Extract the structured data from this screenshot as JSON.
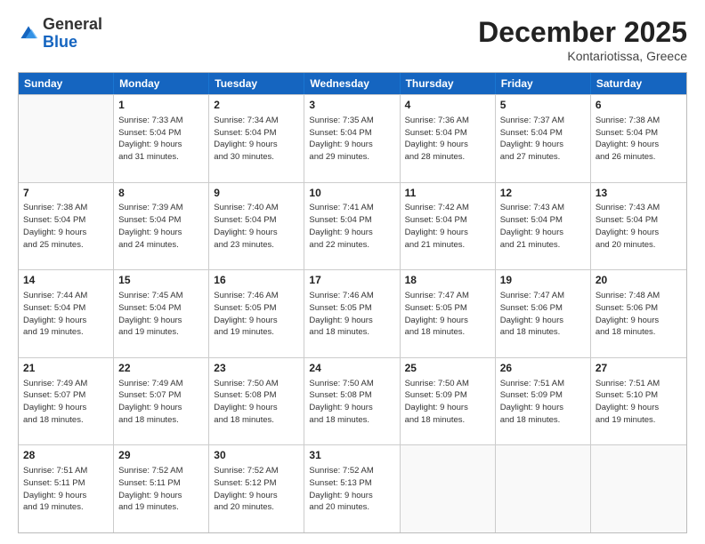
{
  "header": {
    "logo_general": "General",
    "logo_blue": "Blue",
    "month_title": "December 2025",
    "location": "Kontariotissa, Greece"
  },
  "days_of_week": [
    "Sunday",
    "Monday",
    "Tuesday",
    "Wednesday",
    "Thursday",
    "Friday",
    "Saturday"
  ],
  "weeks": [
    [
      {
        "day": "",
        "info": ""
      },
      {
        "day": "1",
        "info": "Sunrise: 7:33 AM\nSunset: 5:04 PM\nDaylight: 9 hours\nand 31 minutes."
      },
      {
        "day": "2",
        "info": "Sunrise: 7:34 AM\nSunset: 5:04 PM\nDaylight: 9 hours\nand 30 minutes."
      },
      {
        "day": "3",
        "info": "Sunrise: 7:35 AM\nSunset: 5:04 PM\nDaylight: 9 hours\nand 29 minutes."
      },
      {
        "day": "4",
        "info": "Sunrise: 7:36 AM\nSunset: 5:04 PM\nDaylight: 9 hours\nand 28 minutes."
      },
      {
        "day": "5",
        "info": "Sunrise: 7:37 AM\nSunset: 5:04 PM\nDaylight: 9 hours\nand 27 minutes."
      },
      {
        "day": "6",
        "info": "Sunrise: 7:38 AM\nSunset: 5:04 PM\nDaylight: 9 hours\nand 26 minutes."
      }
    ],
    [
      {
        "day": "7",
        "info": "Sunrise: 7:38 AM\nSunset: 5:04 PM\nDaylight: 9 hours\nand 25 minutes."
      },
      {
        "day": "8",
        "info": "Sunrise: 7:39 AM\nSunset: 5:04 PM\nDaylight: 9 hours\nand 24 minutes."
      },
      {
        "day": "9",
        "info": "Sunrise: 7:40 AM\nSunset: 5:04 PM\nDaylight: 9 hours\nand 23 minutes."
      },
      {
        "day": "10",
        "info": "Sunrise: 7:41 AM\nSunset: 5:04 PM\nDaylight: 9 hours\nand 22 minutes."
      },
      {
        "day": "11",
        "info": "Sunrise: 7:42 AM\nSunset: 5:04 PM\nDaylight: 9 hours\nand 21 minutes."
      },
      {
        "day": "12",
        "info": "Sunrise: 7:43 AM\nSunset: 5:04 PM\nDaylight: 9 hours\nand 21 minutes."
      },
      {
        "day": "13",
        "info": "Sunrise: 7:43 AM\nSunset: 5:04 PM\nDaylight: 9 hours\nand 20 minutes."
      }
    ],
    [
      {
        "day": "14",
        "info": "Sunrise: 7:44 AM\nSunset: 5:04 PM\nDaylight: 9 hours\nand 19 minutes."
      },
      {
        "day": "15",
        "info": "Sunrise: 7:45 AM\nSunset: 5:04 PM\nDaylight: 9 hours\nand 19 minutes."
      },
      {
        "day": "16",
        "info": "Sunrise: 7:46 AM\nSunset: 5:05 PM\nDaylight: 9 hours\nand 19 minutes."
      },
      {
        "day": "17",
        "info": "Sunrise: 7:46 AM\nSunset: 5:05 PM\nDaylight: 9 hours\nand 18 minutes."
      },
      {
        "day": "18",
        "info": "Sunrise: 7:47 AM\nSunset: 5:05 PM\nDaylight: 9 hours\nand 18 minutes."
      },
      {
        "day": "19",
        "info": "Sunrise: 7:47 AM\nSunset: 5:06 PM\nDaylight: 9 hours\nand 18 minutes."
      },
      {
        "day": "20",
        "info": "Sunrise: 7:48 AM\nSunset: 5:06 PM\nDaylight: 9 hours\nand 18 minutes."
      }
    ],
    [
      {
        "day": "21",
        "info": "Sunrise: 7:49 AM\nSunset: 5:07 PM\nDaylight: 9 hours\nand 18 minutes."
      },
      {
        "day": "22",
        "info": "Sunrise: 7:49 AM\nSunset: 5:07 PM\nDaylight: 9 hours\nand 18 minutes."
      },
      {
        "day": "23",
        "info": "Sunrise: 7:50 AM\nSunset: 5:08 PM\nDaylight: 9 hours\nand 18 minutes."
      },
      {
        "day": "24",
        "info": "Sunrise: 7:50 AM\nSunset: 5:08 PM\nDaylight: 9 hours\nand 18 minutes."
      },
      {
        "day": "25",
        "info": "Sunrise: 7:50 AM\nSunset: 5:09 PM\nDaylight: 9 hours\nand 18 minutes."
      },
      {
        "day": "26",
        "info": "Sunrise: 7:51 AM\nSunset: 5:09 PM\nDaylight: 9 hours\nand 18 minutes."
      },
      {
        "day": "27",
        "info": "Sunrise: 7:51 AM\nSunset: 5:10 PM\nDaylight: 9 hours\nand 19 minutes."
      }
    ],
    [
      {
        "day": "28",
        "info": "Sunrise: 7:51 AM\nSunset: 5:11 PM\nDaylight: 9 hours\nand 19 minutes."
      },
      {
        "day": "29",
        "info": "Sunrise: 7:52 AM\nSunset: 5:11 PM\nDaylight: 9 hours\nand 19 minutes."
      },
      {
        "day": "30",
        "info": "Sunrise: 7:52 AM\nSunset: 5:12 PM\nDaylight: 9 hours\nand 20 minutes."
      },
      {
        "day": "31",
        "info": "Sunrise: 7:52 AM\nSunset: 5:13 PM\nDaylight: 9 hours\nand 20 minutes."
      },
      {
        "day": "",
        "info": ""
      },
      {
        "day": "",
        "info": ""
      },
      {
        "day": "",
        "info": ""
      }
    ]
  ]
}
